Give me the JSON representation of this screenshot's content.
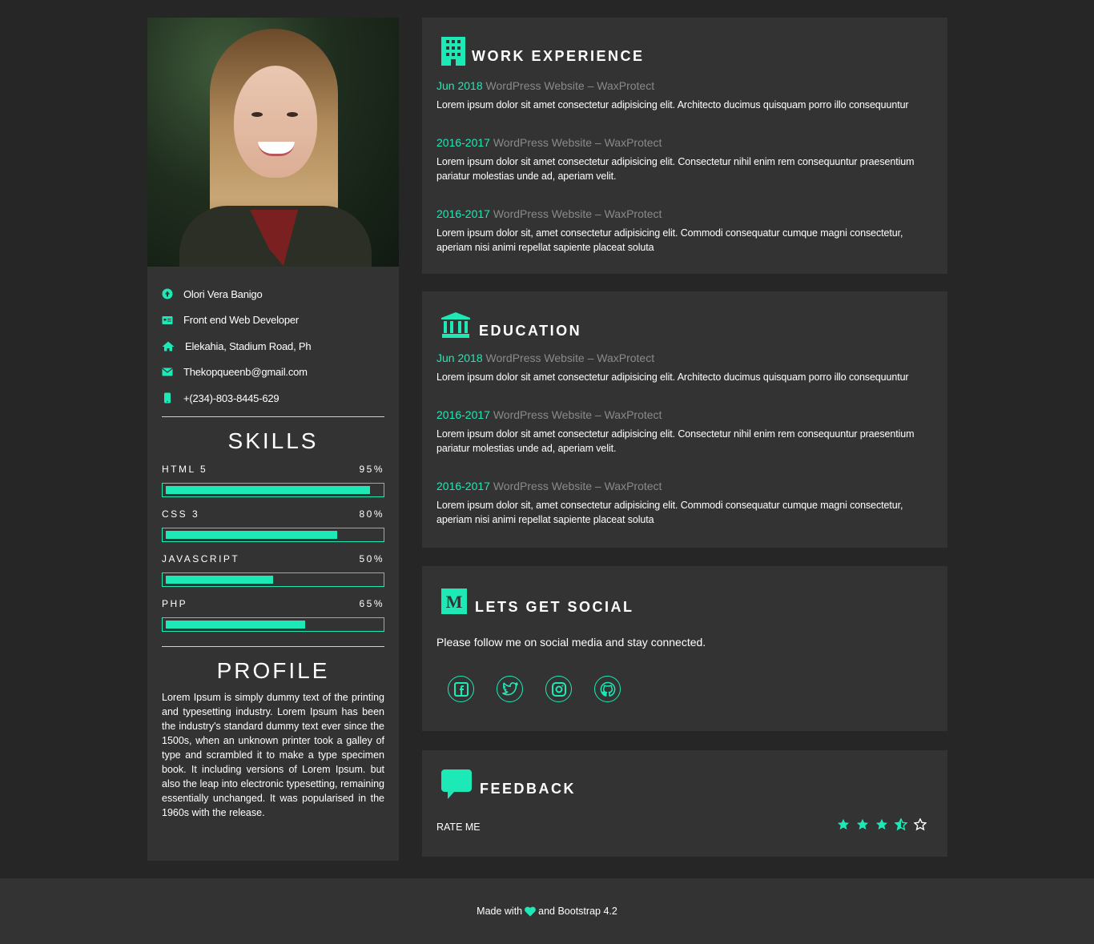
{
  "colors": {
    "accent": "#1de9b6",
    "card_bg": "#333333",
    "page_bg": "#262626",
    "muted": "#8a8a8a"
  },
  "sidebar": {
    "info": [
      {
        "icon": "user-circle-icon",
        "text": "Olori Vera Banigo"
      },
      {
        "icon": "id-card-icon",
        "text": "Front end Web Developer"
      },
      {
        "icon": "home-icon",
        "text": "Elekahia, Stadium Road, Ph"
      },
      {
        "icon": "envelope-icon",
        "text": "Thekopqueenb@gmail.com"
      },
      {
        "icon": "mobile-phone-icon",
        "text": "+(234)-803-8445-629"
      }
    ],
    "skills_title": "SKILLS",
    "skills": [
      {
        "name": "HTML 5",
        "percent_label": "95%",
        "level": 0.95
      },
      {
        "name": "CSS 3",
        "percent_label": "80%",
        "level": 0.8
      },
      {
        "name": "JAVASCRIPT",
        "percent_label": "50%",
        "level": 0.5
      },
      {
        "name": "PHP",
        "percent_label": "65%",
        "level": 0.65
      }
    ],
    "profile_title": "PROFILE",
    "profile_text": "Lorem Ipsum is simply dummy text of the printing and typesetting industry. Lorem Ipsum has been the industry's standard dummy text ever since the 1500s, when an unknown printer took a galley of type and scrambled it to make a type specimen book. It including versions of Lorem Ipsum. but also the leap into electronic typesetting, remaining essentially unchanged. It was popularised in the 1960s with the release."
  },
  "work": {
    "title": "WORK EXPERIENCE",
    "icon": "building-icon",
    "entries": [
      {
        "date": "Jun 2018",
        "where": "WordPress Website – WaxProtect",
        "desc": "Lorem ipsum dolor sit amet consectetur adipisicing elit. Architecto ducimus quisquam porro illo consequuntur"
      },
      {
        "date": "2016-2017",
        "where": "WordPress Website – WaxProtect",
        "desc": "Lorem ipsum dolor sit amet consectetur adipisicing elit. Consectetur nihil enim rem consequuntur praesentium pariatur molestias unde ad, aperiam velit."
      },
      {
        "date": "2016-2017",
        "where": "WordPress Website – WaxProtect",
        "desc": "Lorem ipsum dolor sit, amet consectetur adipisicing elit. Commodi consequatur cumque magni consectetur, aperiam nisi animi repellat sapiente placeat soluta"
      }
    ]
  },
  "education": {
    "title": "EDUCATION",
    "icon": "university-icon",
    "entries": [
      {
        "date": "Jun 2018",
        "where": "WordPress Website – WaxProtect",
        "desc": "Lorem ipsum dolor sit amet consectetur adipisicing elit. Architecto ducimus quisquam porro illo consequuntur"
      },
      {
        "date": "2016-2017",
        "where": "WordPress Website – WaxProtect",
        "desc": "Lorem ipsum dolor sit amet consectetur adipisicing elit. Consectetur nihil enim rem consequuntur praesentium pariatur molestias unde ad, aperiam velit."
      },
      {
        "date": "2016-2017",
        "where": "WordPress Website – WaxProtect",
        "desc": "Lorem ipsum dolor sit, amet consectetur adipisicing elit. Commodi consequatur cumque magni consectetur, aperiam nisi animi repellat sapiente placeat soluta"
      }
    ]
  },
  "social": {
    "title": "LETS GET SOCIAL",
    "icon": "medium-icon",
    "text": "Please follow me on social media and stay connected.",
    "links": [
      "facebook-icon",
      "twitter-icon",
      "instagram-icon",
      "github-icon"
    ]
  },
  "feedback": {
    "title": "FEEDBACK",
    "icon": "comment-icon",
    "rate_label": "RATE ME",
    "rating": 3.5,
    "max_rating": 5
  },
  "footer": {
    "prefix": "Made with",
    "suffix": "and Bootstrap 4.2"
  }
}
